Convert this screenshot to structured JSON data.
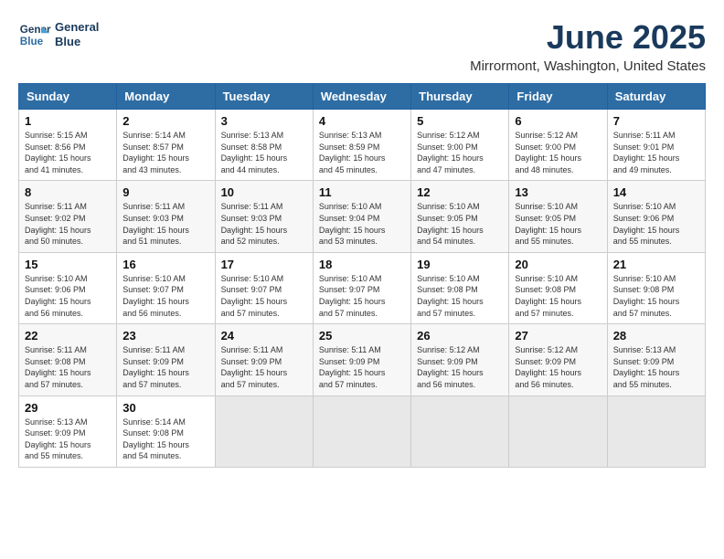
{
  "logo": {
    "line1": "General",
    "line2": "Blue"
  },
  "title": "June 2025",
  "location": "Mirrormont, Washington, United States",
  "weekdays": [
    "Sunday",
    "Monday",
    "Tuesday",
    "Wednesday",
    "Thursday",
    "Friday",
    "Saturday"
  ],
  "weeks": [
    [
      {
        "day": "1",
        "sunrise": "5:15 AM",
        "sunset": "8:56 PM",
        "daylight": "15 hours and 41 minutes."
      },
      {
        "day": "2",
        "sunrise": "5:14 AM",
        "sunset": "8:57 PM",
        "daylight": "15 hours and 43 minutes."
      },
      {
        "day": "3",
        "sunrise": "5:13 AM",
        "sunset": "8:58 PM",
        "daylight": "15 hours and 44 minutes."
      },
      {
        "day": "4",
        "sunrise": "5:13 AM",
        "sunset": "8:59 PM",
        "daylight": "15 hours and 45 minutes."
      },
      {
        "day": "5",
        "sunrise": "5:12 AM",
        "sunset": "9:00 PM",
        "daylight": "15 hours and 47 minutes."
      },
      {
        "day": "6",
        "sunrise": "5:12 AM",
        "sunset": "9:00 PM",
        "daylight": "15 hours and 48 minutes."
      },
      {
        "day": "7",
        "sunrise": "5:11 AM",
        "sunset": "9:01 PM",
        "daylight": "15 hours and 49 minutes."
      }
    ],
    [
      {
        "day": "8",
        "sunrise": "5:11 AM",
        "sunset": "9:02 PM",
        "daylight": "15 hours and 50 minutes."
      },
      {
        "day": "9",
        "sunrise": "5:11 AM",
        "sunset": "9:03 PM",
        "daylight": "15 hours and 51 minutes."
      },
      {
        "day": "10",
        "sunrise": "5:11 AM",
        "sunset": "9:03 PM",
        "daylight": "15 hours and 52 minutes."
      },
      {
        "day": "11",
        "sunrise": "5:10 AM",
        "sunset": "9:04 PM",
        "daylight": "15 hours and 53 minutes."
      },
      {
        "day": "12",
        "sunrise": "5:10 AM",
        "sunset": "9:05 PM",
        "daylight": "15 hours and 54 minutes."
      },
      {
        "day": "13",
        "sunrise": "5:10 AM",
        "sunset": "9:05 PM",
        "daylight": "15 hours and 55 minutes."
      },
      {
        "day": "14",
        "sunrise": "5:10 AM",
        "sunset": "9:06 PM",
        "daylight": "15 hours and 55 minutes."
      }
    ],
    [
      {
        "day": "15",
        "sunrise": "5:10 AM",
        "sunset": "9:06 PM",
        "daylight": "15 hours and 56 minutes."
      },
      {
        "day": "16",
        "sunrise": "5:10 AM",
        "sunset": "9:07 PM",
        "daylight": "15 hours and 56 minutes."
      },
      {
        "day": "17",
        "sunrise": "5:10 AM",
        "sunset": "9:07 PM",
        "daylight": "15 hours and 57 minutes."
      },
      {
        "day": "18",
        "sunrise": "5:10 AM",
        "sunset": "9:07 PM",
        "daylight": "15 hours and 57 minutes."
      },
      {
        "day": "19",
        "sunrise": "5:10 AM",
        "sunset": "9:08 PM",
        "daylight": "15 hours and 57 minutes."
      },
      {
        "day": "20",
        "sunrise": "5:10 AM",
        "sunset": "9:08 PM",
        "daylight": "15 hours and 57 minutes."
      },
      {
        "day": "21",
        "sunrise": "5:10 AM",
        "sunset": "9:08 PM",
        "daylight": "15 hours and 57 minutes."
      }
    ],
    [
      {
        "day": "22",
        "sunrise": "5:11 AM",
        "sunset": "9:08 PM",
        "daylight": "15 hours and 57 minutes."
      },
      {
        "day": "23",
        "sunrise": "5:11 AM",
        "sunset": "9:09 PM",
        "daylight": "15 hours and 57 minutes."
      },
      {
        "day": "24",
        "sunrise": "5:11 AM",
        "sunset": "9:09 PM",
        "daylight": "15 hours and 57 minutes."
      },
      {
        "day": "25",
        "sunrise": "5:11 AM",
        "sunset": "9:09 PM",
        "daylight": "15 hours and 57 minutes."
      },
      {
        "day": "26",
        "sunrise": "5:12 AM",
        "sunset": "9:09 PM",
        "daylight": "15 hours and 56 minutes."
      },
      {
        "day": "27",
        "sunrise": "5:12 AM",
        "sunset": "9:09 PM",
        "daylight": "15 hours and 56 minutes."
      },
      {
        "day": "28",
        "sunrise": "5:13 AM",
        "sunset": "9:09 PM",
        "daylight": "15 hours and 55 minutes."
      }
    ],
    [
      {
        "day": "29",
        "sunrise": "5:13 AM",
        "sunset": "9:09 PM",
        "daylight": "15 hours and 55 minutes."
      },
      {
        "day": "30",
        "sunrise": "5:14 AM",
        "sunset": "9:08 PM",
        "daylight": "15 hours and 54 minutes."
      },
      null,
      null,
      null,
      null,
      null
    ]
  ]
}
